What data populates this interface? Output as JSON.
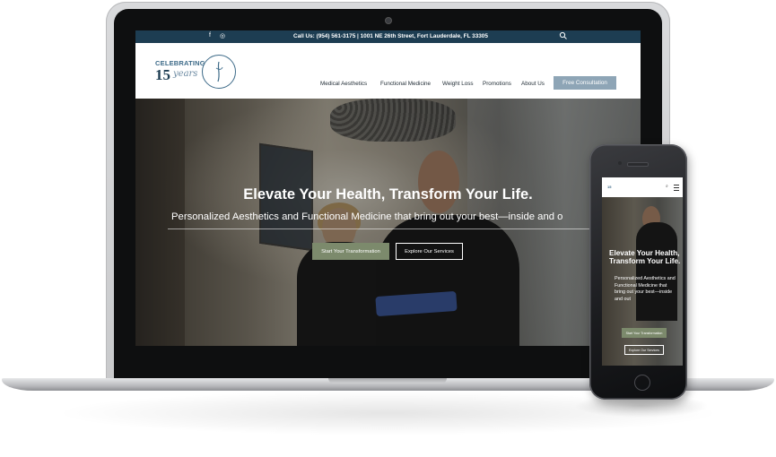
{
  "topbar": {
    "social": [
      "f",
      "◎"
    ],
    "info": "Call Us: (954) 561-3175 | 1001 NE 26th Street, Fort Lauderdale, FL 33305"
  },
  "logo": {
    "top_text": "CELEBRATING",
    "number": "15",
    "script_text": "years"
  },
  "nav": {
    "items": [
      "Medical Aesthetics",
      "Functional Medicine",
      "Weight Loss",
      "Promotions",
      "About Us"
    ],
    "cta": "Free Consultation"
  },
  "hero": {
    "title": "Elevate Your Health, Transform Your Life.",
    "subtitle": "Personalized Aesthetics and Functional Medicine that bring out your best—inside and o",
    "primary_button": "Start Your Transformation",
    "secondary_button": "Explore Our Services"
  },
  "phone": {
    "logo": "15",
    "title": "Elevate Your Health, Transform Your Life.",
    "subtitle": "Personalized Aesthetics and Functional Medicine that bring out your best—inside and out",
    "primary_button": "Start Your Transformation",
    "secondary_button": "Explore Our Services"
  },
  "colors": {
    "topbar": "#1d3d52",
    "cta": "#8ea5b6",
    "primary_button": "#7c8a6c"
  }
}
